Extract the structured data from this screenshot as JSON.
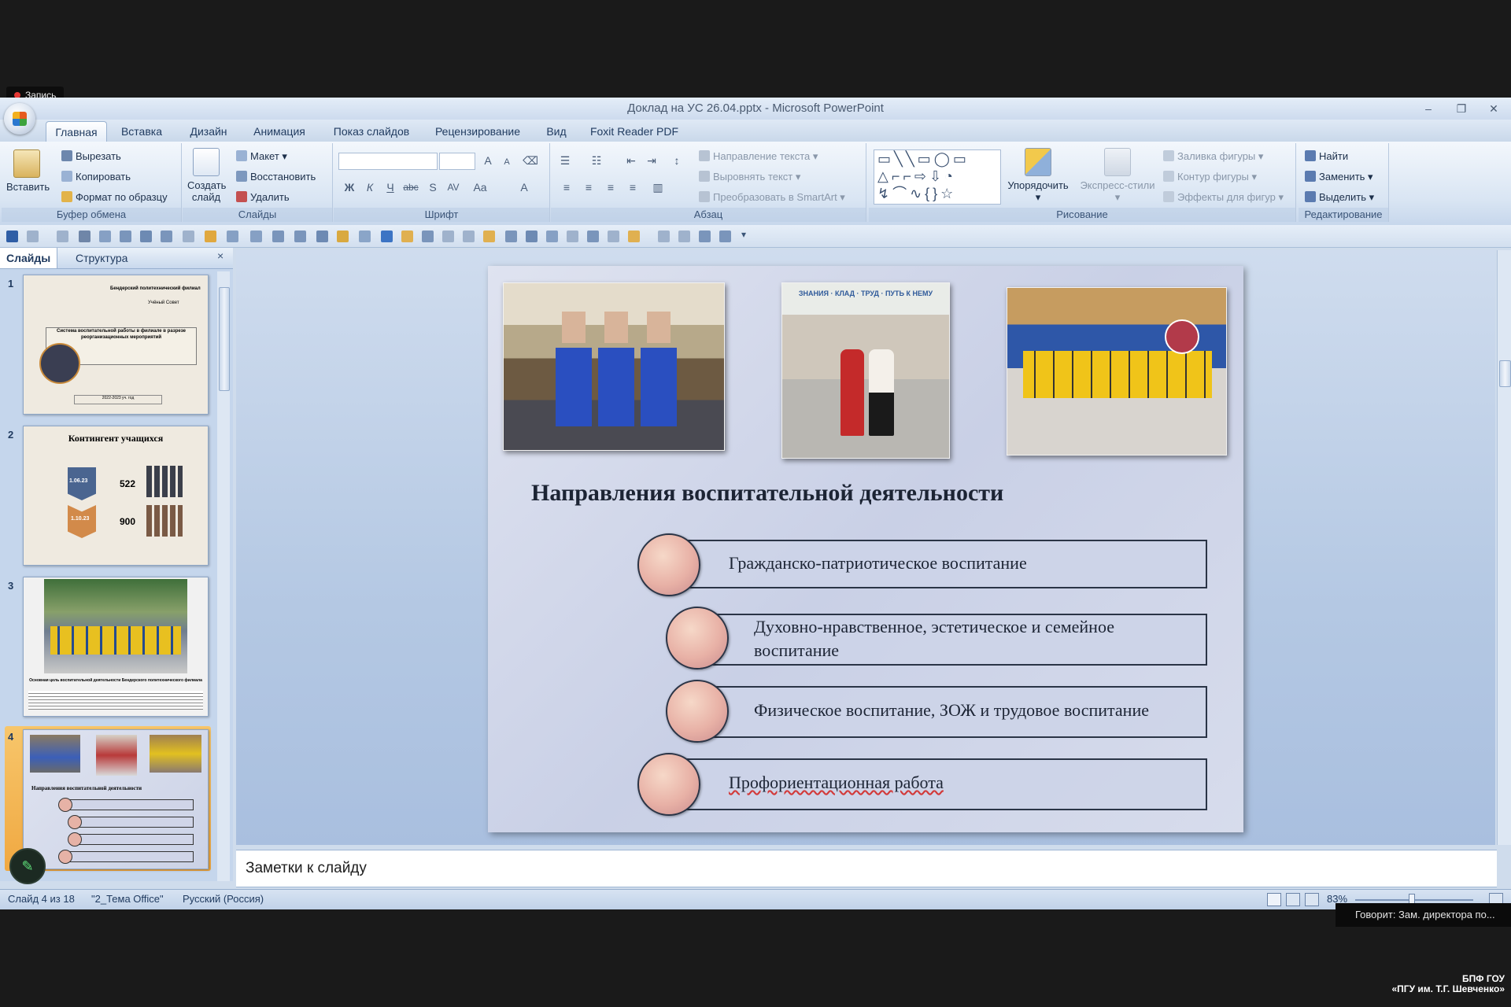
{
  "recording": {
    "label": "Запись"
  },
  "window": {
    "title": "Доклад на УС 26.04.pptx - Microsoft PowerPoint",
    "minimize": "–",
    "maximize": "❐",
    "close": "✕"
  },
  "tabs": [
    "Главная",
    "Вставка",
    "Дизайн",
    "Анимация",
    "Показ слайдов",
    "Рецензирование",
    "Вид",
    "Foxit Reader PDF"
  ],
  "ribbon": {
    "clipboard": {
      "paste": "Вставить",
      "cut": "Вырезать",
      "copy": "Копировать",
      "format_painter": "Формат по образцу",
      "label": "Буфер обмена"
    },
    "slides": {
      "new_slide_1": "Создать",
      "new_slide_2": "слайд",
      "layout": "Макет",
      "reset": "Восстановить",
      "delete": "Удалить",
      "label": "Слайды"
    },
    "font": {
      "label": "Шрифт",
      "bold": "Ж",
      "italic": "К",
      "underline": "Ч",
      "strike": "abc",
      "shadow": "S",
      "spacing": "AV",
      "case": "Aa",
      "grow": "A",
      "shrink": "A"
    },
    "paragraph": {
      "text_direction": "Направление текста",
      "align_text": "Выровнять текст",
      "smartart": "Преобразовать в SmartArt",
      "label": "Абзац"
    },
    "drawing": {
      "arrange": "Упорядочить",
      "quick_styles": "Экспресс-стили",
      "fill": "Заливка фигуры",
      "outline": "Контур фигуры",
      "effects": "Эффекты для фигур",
      "label": "Рисование"
    },
    "editing": {
      "find": "Найти",
      "replace": "Заменить",
      "select": "Выделить",
      "label": "Редактирование"
    }
  },
  "left_pane": {
    "tab_slides": "Слайды",
    "tab_outline": "Структура",
    "close": "×",
    "thumbnails": [
      {
        "num": "1",
        "t1": "Бендерский политехнический филиал",
        "t2": "Учёный Совет",
        "t3": "Система воспитательной работы в филиале в разрезе реорганизационных мероприятий",
        "t4": "2022-2023 уч. год"
      },
      {
        "num": "2",
        "title": "Контингент учащихся",
        "d1": "1.06.23",
        "d2": "1.10.23",
        "v1": "522",
        "v2": "900"
      },
      {
        "num": "3",
        "caption": "Основная цель воспитательной деятельности Бендерского политехнического филиала"
      },
      {
        "num": "4",
        "title": "Направления воспитательной деятельности"
      }
    ]
  },
  "slide": {
    "title": "Направления воспитательной деятельности",
    "photo2_banner": "ЗНАНИЯ · КЛАД · ТРУД · ПУТЬ К НЕМУ",
    "directions": [
      "Гражданско-патриотическое воспитание",
      "Духовно-нравственное, эстетическое и семейное воспитание",
      "Физическое воспитание, ЗОЖ и трудовое воспитание",
      "Профориентационная работа"
    ]
  },
  "notes": {
    "placeholder": "Заметки к слайду"
  },
  "status": {
    "slide_info": "Слайд 4 из 18",
    "theme": "\"2_Тема Office\"",
    "language": "Русский (Россия)",
    "zoom": "83%"
  },
  "speaker": {
    "text": "Говорит: Зам. директора по..."
  },
  "watermark": {
    "line1": "БПФ ГОУ",
    "line2": "«ПГУ им. Т.Г. Шевченко»"
  },
  "colors": {
    "accent": "#2b5797",
    "selected_thumb": "#f0a841",
    "record": "#e53935"
  }
}
